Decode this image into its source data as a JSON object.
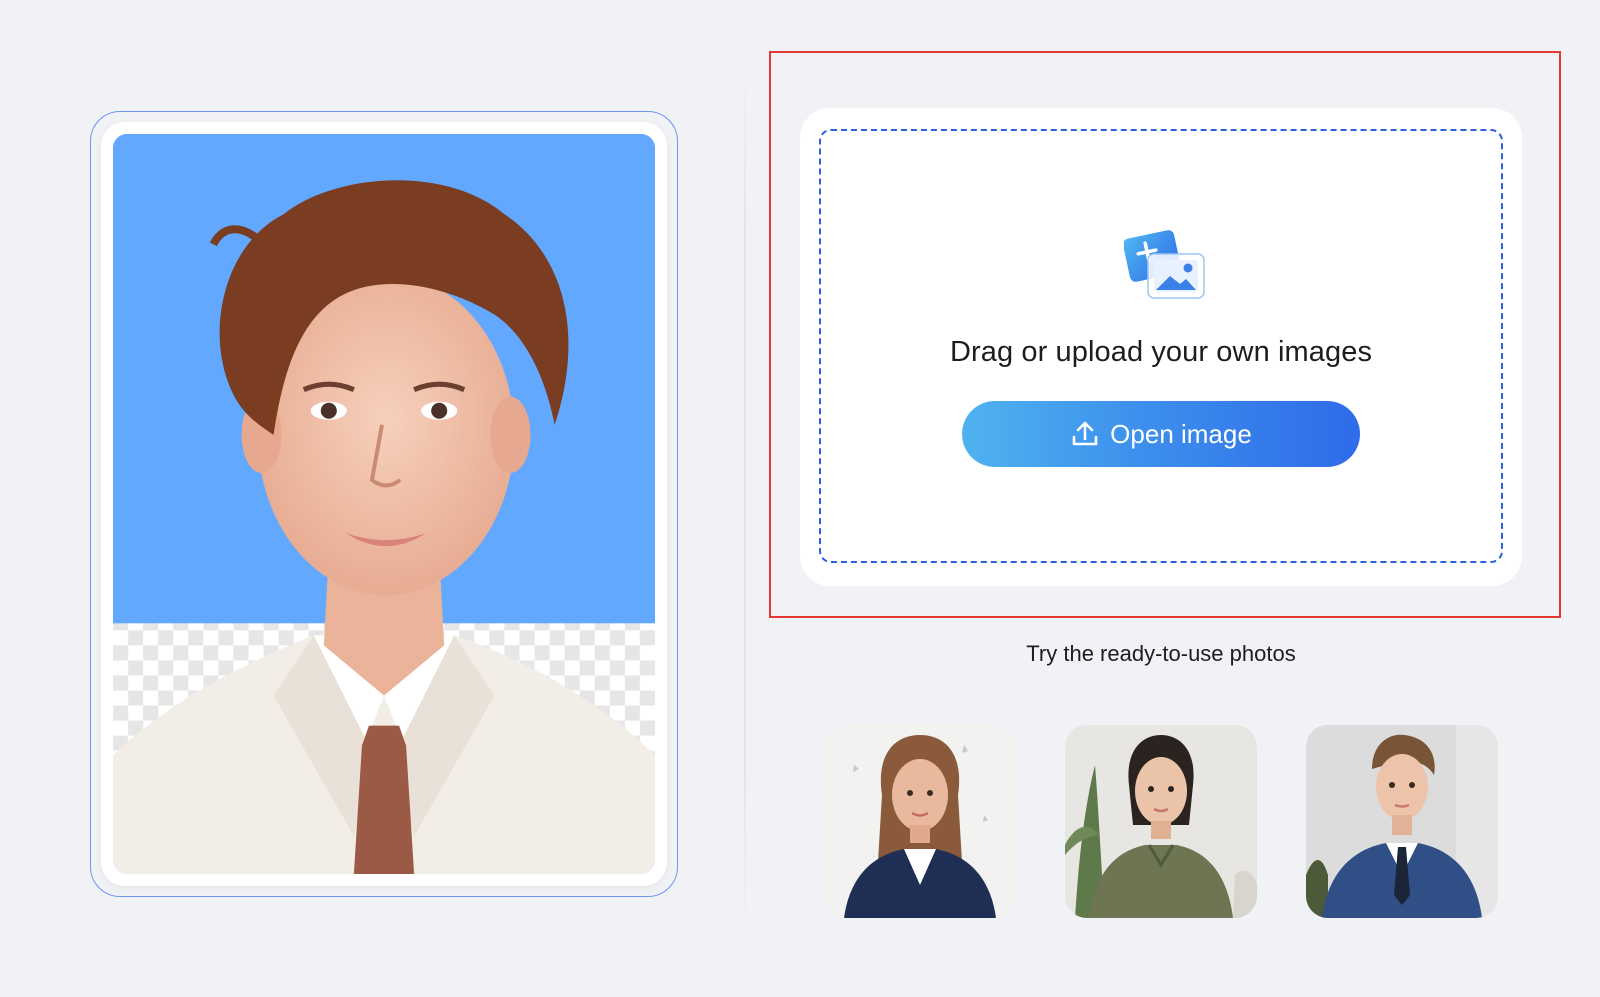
{
  "upload": {
    "prompt": "Drag or upload your own images",
    "button_label": "Open image",
    "icon": "image-add-icon",
    "button_icon": "upload-icon"
  },
  "samples": {
    "title": "Try the ready-to-use photos",
    "items": [
      {
        "name": "sample-woman-navy-blazer"
      },
      {
        "name": "sample-woman-olive-shirt"
      },
      {
        "name": "sample-man-blue-suit"
      }
    ]
  },
  "colors": {
    "accent": "#2d5fe0",
    "button_start": "#4fb3ef",
    "button_end": "#2e6bea",
    "preview_background": "#62a8ff",
    "highlight": "#e53935"
  }
}
